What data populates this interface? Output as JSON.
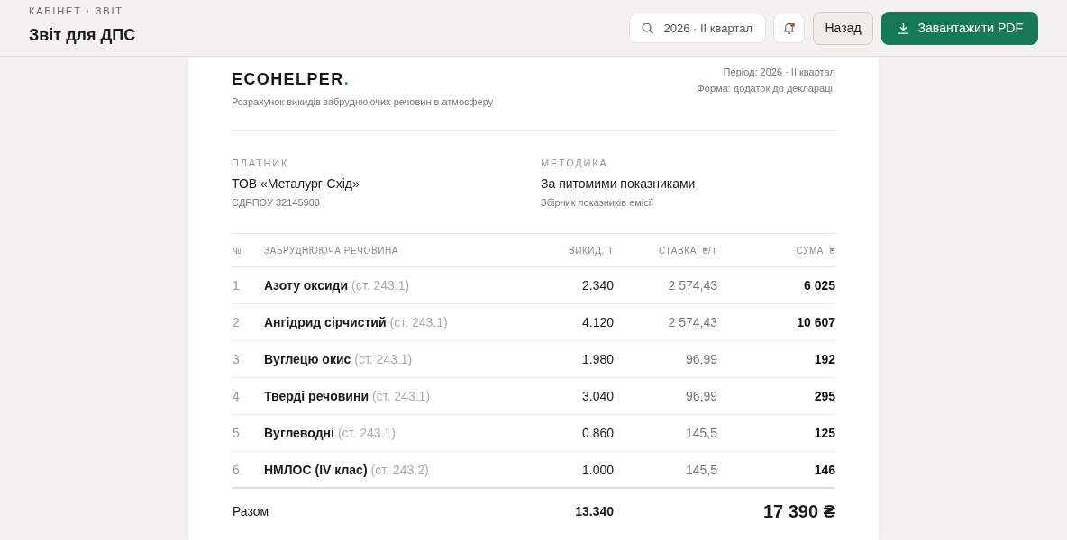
{
  "header": {
    "breadcrumb": "КАБІНЕТ · ЗВІТ",
    "title": "Звіт для ДПС"
  },
  "toolbar": {
    "period_field": {
      "value": "2026 · II квартал"
    },
    "notifications": {
      "unread": true
    },
    "buttons": [
      {
        "label": "Назад",
        "kind": "secondary"
      },
      {
        "label": "Завантажити PDF",
        "kind": "primary"
      }
    ]
  },
  "document": {
    "logo": {
      "name": "ECOHELPER",
      "dot": "."
    },
    "subtitle": "Розрахунок викидів забруднюючих речовин в атмосферу",
    "meta": [
      "Період: 2026 · II квартал",
      "Форма: додаток до декларації"
    ],
    "parties": [
      {
        "label": "ПЛАТНИК",
        "value": "ТОВ «Металург-Схід»",
        "note": "ЄДРПОУ 32145908"
      },
      {
        "label": "МЕТОДИКА",
        "value": "За питомими показниками",
        "note": "Збірник показників емісії"
      }
    ],
    "table": {
      "columns": [
        "№",
        "ЗАБРУДНЮЮЧА РЕЧОВИНА",
        "ВИКИД, Т",
        "СТАВКА, ₴/Т",
        "СУМА, ₴"
      ],
      "rows": [
        {
          "no": "1",
          "substance": "Азоту оксиди",
          "article": "(ст. 243.1)",
          "emission": "2.340",
          "rate": "2 574,43",
          "sum": "6 025"
        },
        {
          "no": "2",
          "substance": "Ангідрид сірчистий",
          "article": "(ст. 243.1)",
          "emission": "4.120",
          "rate": "2 574,43",
          "sum": "10 607"
        },
        {
          "no": "3",
          "substance": "Вуглецю окис",
          "article": "(ст. 243.1)",
          "emission": "1.980",
          "rate": "96,99",
          "sum": "192"
        },
        {
          "no": "4",
          "substance": "Тверді речовини",
          "article": "(ст. 243.1)",
          "emission": "3.040",
          "rate": "96,99",
          "sum": "295"
        },
        {
          "no": "5",
          "substance": "Вуглеводні",
          "article": "(ст. 243.1)",
          "emission": "0.860",
          "rate": "145,5",
          "sum": "125"
        },
        {
          "no": "6",
          "substance": "НМЛОС (IV клас)",
          "article": "(ст. 243.2)",
          "emission": "1.000",
          "rate": "145,5",
          "sum": "146"
        }
      ],
      "total": {
        "label": "Разом",
        "emission": "13.340",
        "sum": "17 390 ₴"
      }
    }
  }
}
